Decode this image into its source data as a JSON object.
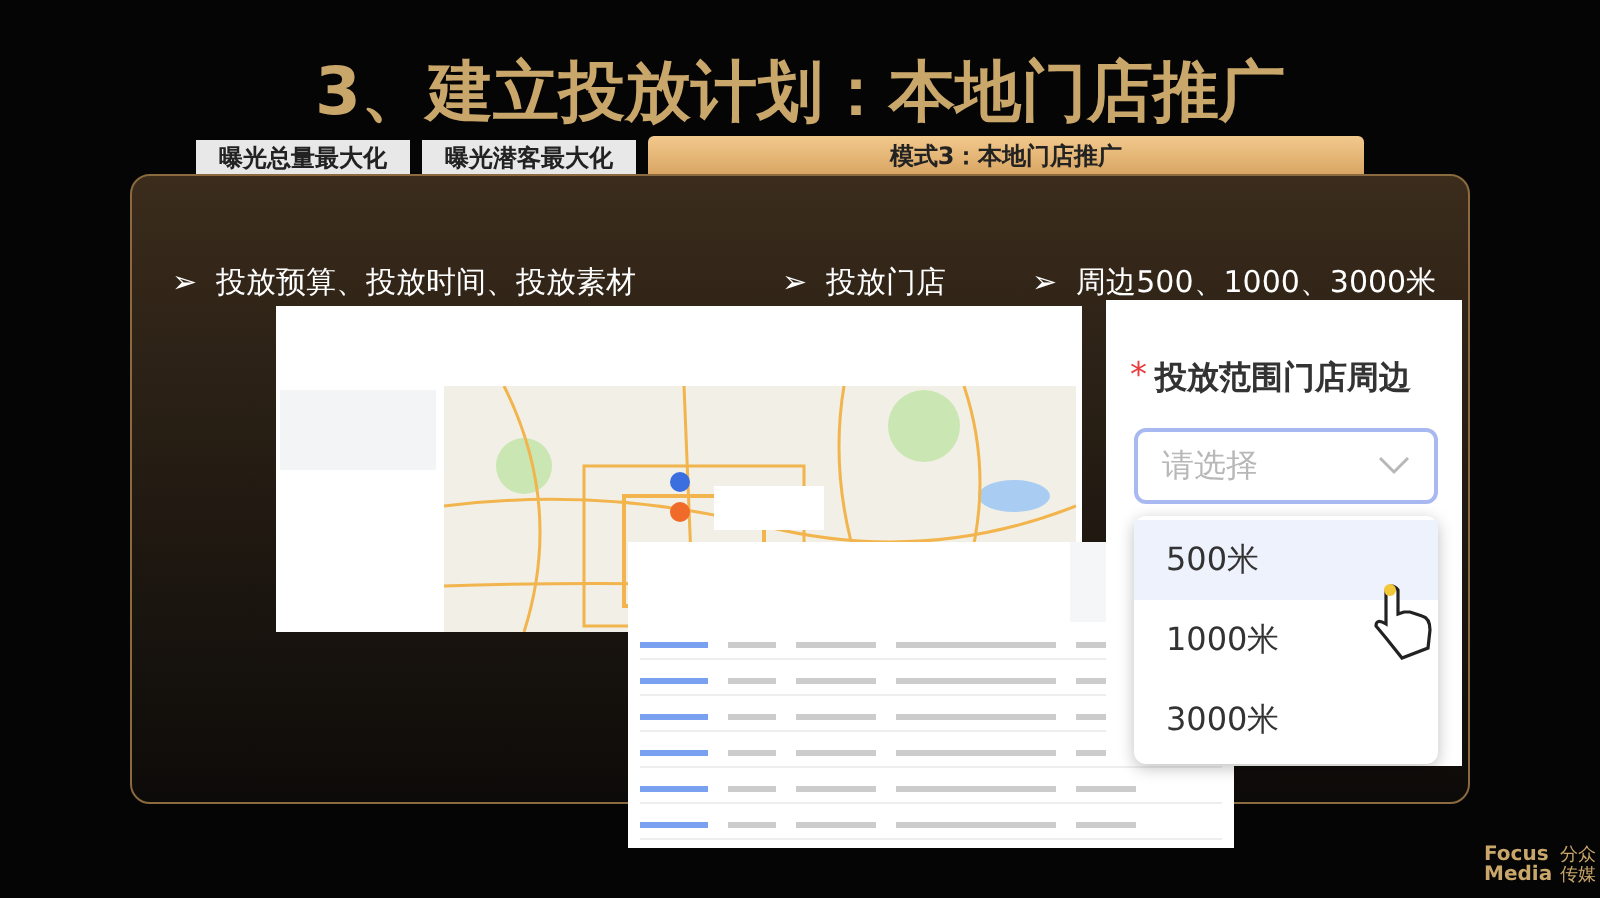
{
  "title": "3、建立投放计划：本地门店推广",
  "tabs": [
    {
      "label": "曝光总量最大化",
      "selected": false
    },
    {
      "label": "曝光潜客最大化",
      "selected": false
    },
    {
      "label": "模式3：本地门店推广",
      "selected": true
    }
  ],
  "bullets": [
    {
      "marker": "➢",
      "text": "投放预算、投放时间、投放素材"
    },
    {
      "marker": "➢",
      "text": "投放门店"
    },
    {
      "marker": "➢",
      "text": "周边500、1000、3000米"
    }
  ],
  "range_form": {
    "required_mark": "*",
    "label": "投放范围门店周边",
    "placeholder": "请选择",
    "options": [
      {
        "label": "500米",
        "selected": true
      },
      {
        "label": "1000米",
        "selected": false
      },
      {
        "label": "3000米",
        "selected": false
      }
    ]
  },
  "logo": {
    "line_1": "Focus",
    "line_2": "Media",
    "cn_1": "分众",
    "cn_2": "传媒"
  }
}
